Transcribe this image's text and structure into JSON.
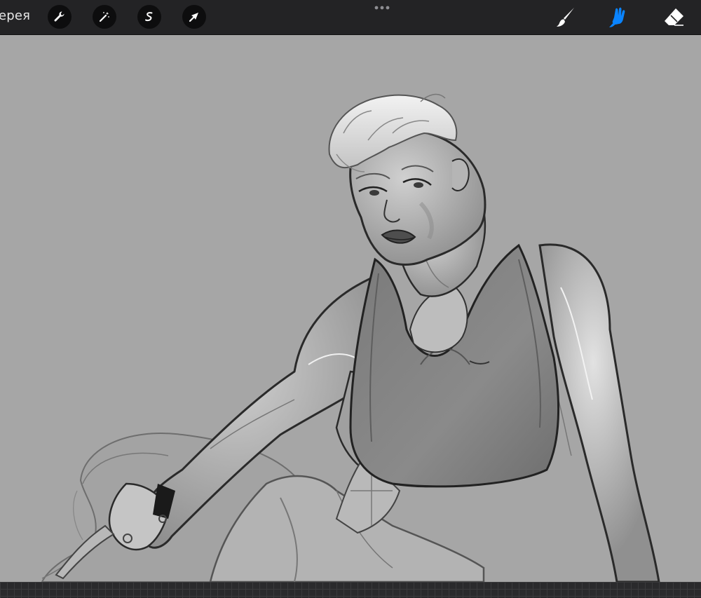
{
  "toolbar": {
    "gallery_label": "ерея",
    "tools_left": [
      {
        "name": "wrench-icon"
      },
      {
        "name": "magic-wand-icon"
      },
      {
        "name": "selection-icon"
      },
      {
        "name": "move-arrow-icon"
      }
    ],
    "tools_right": [
      {
        "name": "brush-icon",
        "active": false
      },
      {
        "name": "smudge-icon",
        "active": true
      },
      {
        "name": "eraser-icon",
        "active": false
      }
    ],
    "active_color": "#0a84ff",
    "icon_color": "#ffffff"
  },
  "canvas": {
    "background_color": "#a6a6a6",
    "artwork": "sketch-figure"
  }
}
